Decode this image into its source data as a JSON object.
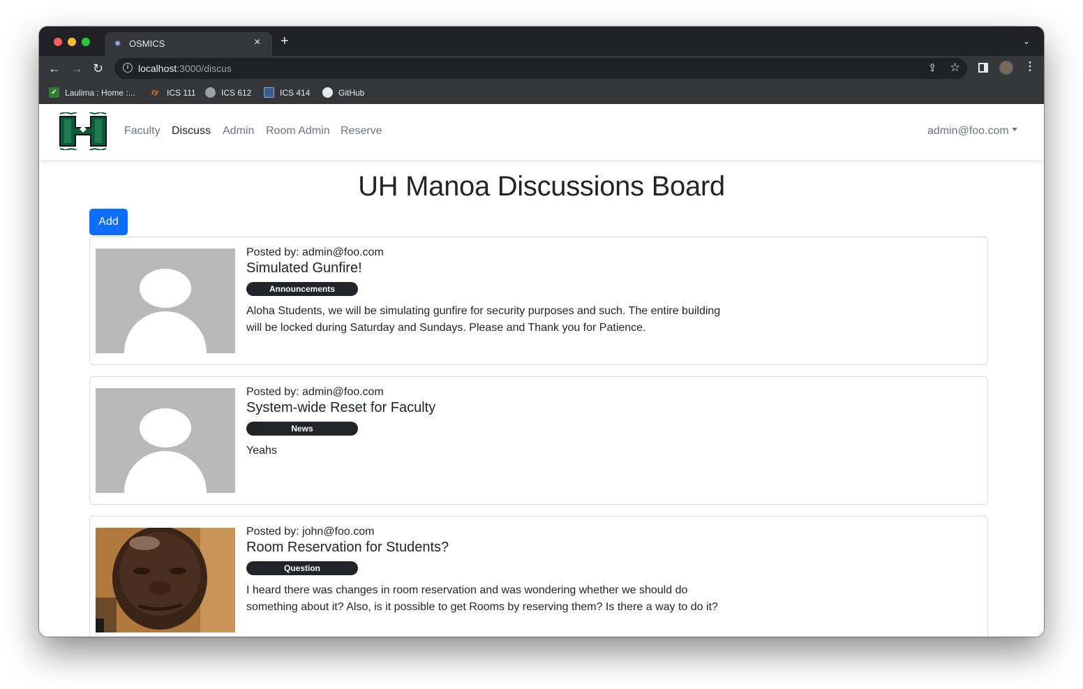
{
  "browser": {
    "tab_title": "OSMICS",
    "new_tab_label": "+",
    "url_host": "localhost",
    "url_path": ":3000/discus",
    "bookmarks": [
      {
        "label": "Laulima : Home :..."
      },
      {
        "label": "ICS 111",
        "icon_text": "zy"
      },
      {
        "label": "ICS 612"
      },
      {
        "label": "ICS 414"
      },
      {
        "label": "GitHub"
      }
    ]
  },
  "navbar": {
    "links": [
      "Faculty",
      "Discuss",
      "Admin",
      "Room Admin",
      "Reserve"
    ],
    "active": "Discuss",
    "user": "admin@foo.com"
  },
  "page": {
    "title": "UH Manoa Discussions Board",
    "add_label": "Add"
  },
  "posts": [
    {
      "posted_by": "Posted by: admin@foo.com",
      "title": "Simulated Gunfire!",
      "tag": "Announcements",
      "body": "Aloha Students, we will be simulating gunfire for security purposes and such. The entire building will be locked during Saturday and Sundays. Please and Thank you for Patience.",
      "avatar": "placeholder"
    },
    {
      "posted_by": "Posted by: admin@foo.com",
      "title": "System-wide Reset for Faculty",
      "tag": "News",
      "body": "Yeahs",
      "avatar": "placeholder"
    },
    {
      "posted_by": "Posted by: john@foo.com",
      "title": "Room Reservation for Students?",
      "tag": "Question",
      "body": "I heard there was changes in room reservation and was wondering whether we should do something about it? Also, is it possible to get Rooms by reserving them? Is there a way to do it?",
      "avatar": "photo"
    }
  ],
  "colors": {
    "primary": "#0d6efd",
    "badge": "#212529",
    "brand_green": "#0b5a3a"
  }
}
